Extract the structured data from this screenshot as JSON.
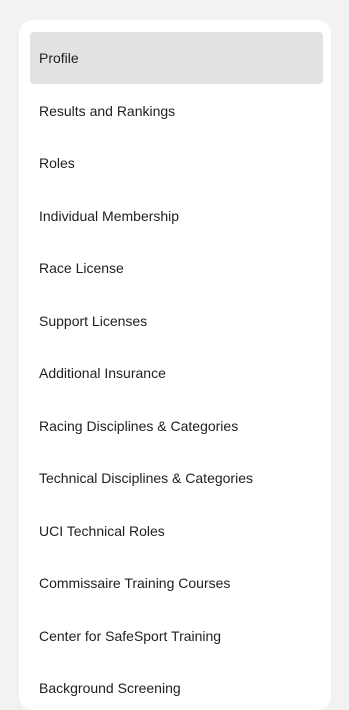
{
  "nav": {
    "items": [
      {
        "label": "Profile",
        "active": true
      },
      {
        "label": "Results and Rankings",
        "active": false
      },
      {
        "label": "Roles",
        "active": false
      },
      {
        "label": "Individual Membership",
        "active": false
      },
      {
        "label": "Race License",
        "active": false
      },
      {
        "label": "Support Licenses",
        "active": false
      },
      {
        "label": "Additional Insurance",
        "active": false
      },
      {
        "label": "Racing Disciplines & Categories",
        "active": false
      },
      {
        "label": "Technical Disciplines & Categories",
        "active": false
      },
      {
        "label": "UCI Technical Roles",
        "active": false
      },
      {
        "label": "Commissaire Training Courses",
        "active": false
      },
      {
        "label": "Center for SafeSport Training",
        "active": false
      },
      {
        "label": "Background Screening",
        "active": false
      }
    ]
  },
  "colors": {
    "page_background": "#f2f2f2",
    "card_background": "#ffffff",
    "active_item_background": "#e2e2e2",
    "text": "#1f1f1f"
  }
}
